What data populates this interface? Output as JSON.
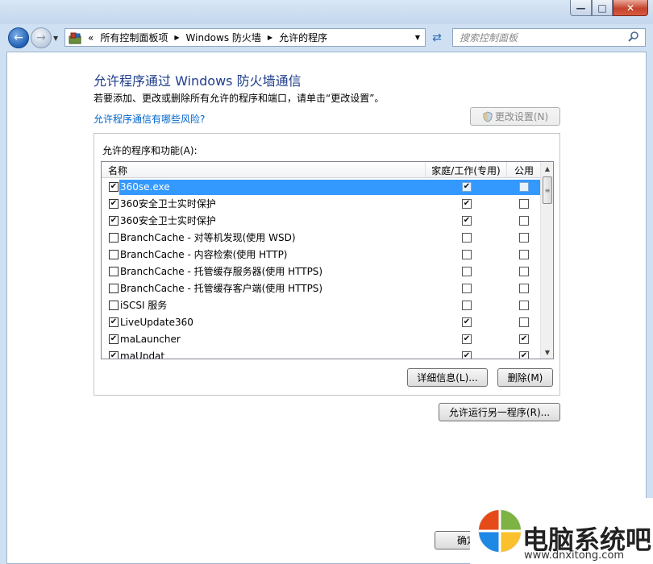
{
  "breadcrumb": {
    "overflow": "«",
    "items": [
      "所有控制面板项",
      "Windows 防火墙",
      "允许的程序"
    ]
  },
  "search": {
    "placeholder": "搜索控制面板"
  },
  "page": {
    "title": "允许程序通过 Windows 防火墙通信",
    "description": "若要添加、更改或删除所有允许的程序和端口，请单击“更改设置”。",
    "risk_link": "允许程序通信有哪些风险?",
    "change_settings": "更改设置(N)"
  },
  "list": {
    "group_label": "允许的程序和功能(A):",
    "columns": {
      "name": "名称",
      "home": "家庭/工作(专用)",
      "public": "公用"
    },
    "rows": [
      {
        "name": "360se.exe",
        "checked": true,
        "home": true,
        "public": false,
        "selected": true
      },
      {
        "name": "360安全卫士实时保护",
        "checked": true,
        "home": true,
        "public": false
      },
      {
        "name": "360安全卫士实时保护",
        "checked": true,
        "home": true,
        "public": false
      },
      {
        "name": "BranchCache - 对等机发现(使用 WSD)",
        "checked": false,
        "home": false,
        "public": false
      },
      {
        "name": "BranchCache - 内容检索(使用 HTTP)",
        "checked": false,
        "home": false,
        "public": false
      },
      {
        "name": "BranchCache - 托管缓存服务器(使用 HTTPS)",
        "checked": false,
        "home": false,
        "public": false
      },
      {
        "name": "BranchCache - 托管缓存客户端(使用 HTTPS)",
        "checked": false,
        "home": false,
        "public": false
      },
      {
        "name": "iSCSI 服务",
        "checked": false,
        "home": false,
        "public": false
      },
      {
        "name": "LiveUpdate360",
        "checked": true,
        "home": true,
        "public": false
      },
      {
        "name": "maLauncher",
        "checked": true,
        "home": true,
        "public": true
      },
      {
        "name": "maUpdat",
        "checked": true,
        "home": true,
        "public": true
      }
    ]
  },
  "buttons": {
    "details": "详细信息(L)...",
    "remove": "删除(M)",
    "allow_another": "允许运行另一程序(R)...",
    "ok": "确定"
  },
  "watermark": {
    "text": "电脑系统吧",
    "url": "www.dnxitong.com"
  }
}
